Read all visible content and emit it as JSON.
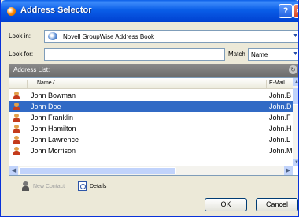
{
  "window": {
    "title": "Address Selector",
    "help_label": "?",
    "close_label": "×"
  },
  "lookin": {
    "label": "Look in:",
    "value": "Novell GroupWise Address Book"
  },
  "lookfor": {
    "label": "Look for:",
    "value": ""
  },
  "match": {
    "label": "Match",
    "value": "Name"
  },
  "address_list": {
    "label": "Address List:",
    "columns": {
      "name": "Name",
      "email": "E-Mail"
    },
    "rows": [
      {
        "name": "John Bowman",
        "email": "John.B"
      },
      {
        "name": "John Doe",
        "email": "John.D",
        "selected": true
      },
      {
        "name": "John Franklin",
        "email": "John.F"
      },
      {
        "name": "John Hamilton",
        "email": "John.H"
      },
      {
        "name": "John Lawrence",
        "email": "John.L"
      },
      {
        "name": "John Morrison",
        "email": "John.M"
      }
    ]
  },
  "toolbar": {
    "new_contact": "New Contact",
    "details": "Details"
  },
  "buttons": {
    "ok": "OK",
    "cancel": "Cancel"
  }
}
